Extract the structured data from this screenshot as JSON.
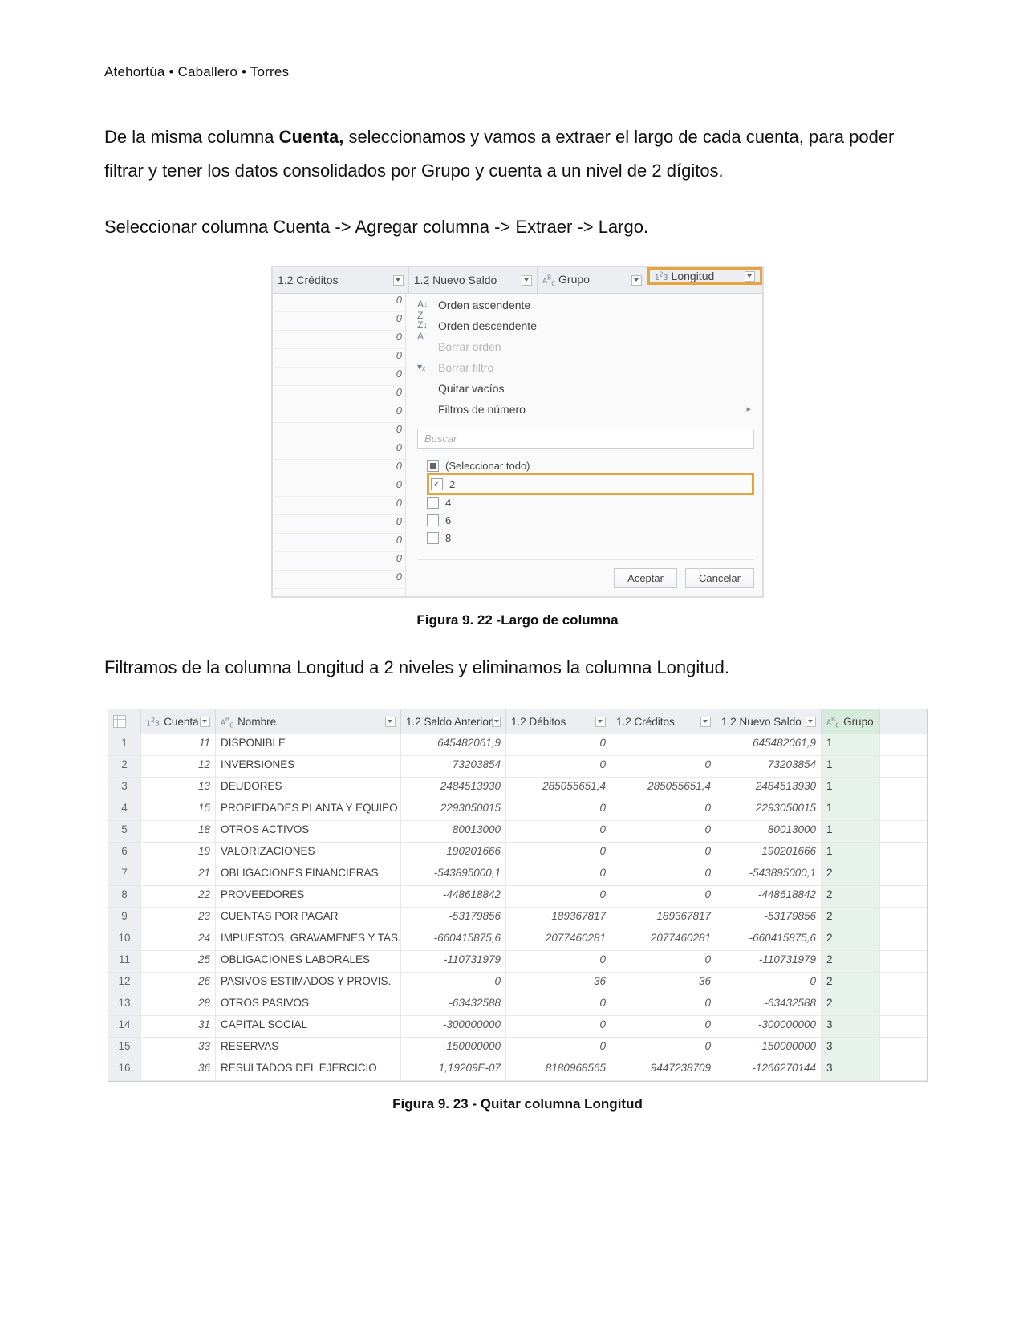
{
  "runhead": "Atehortúa • Caballero • Torres",
  "para1_pre": "De la misma columna ",
  "para1_bold": "Cuenta,",
  "para1_post": " seleccionamos  y vamos a extraer el largo de cada cuenta, para poder filtrar y tener los datos consolidados por Grupo y cuenta a un nivel de 2 dígitos.",
  "para2": "Seleccionar columna Cuenta -> Agregar columna -> Extraer -> Largo.",
  "fig22": {
    "caption": "Figura 9. 22  -Largo de columna",
    "col_creditos": "1.2  Créditos",
    "col_nuevo_saldo": "1.2  Nuevo Saldo",
    "col_grupo": "Grupo",
    "col_longitud": "Longitud",
    "left_zeros": [
      "0",
      "0",
      "0",
      "0",
      "0",
      "0",
      "0",
      "0",
      "0",
      "0",
      "0",
      "0",
      "0",
      "0",
      "0",
      "0"
    ],
    "menu": {
      "asc": "Orden ascendente",
      "desc": "Orden descendente",
      "borrar_orden": "Borrar orden",
      "borrar_filtro": "Borrar filtro",
      "quitar_vacios": "Quitar vacíos",
      "filtros_num": "Filtros de número",
      "search_ph": "Buscar",
      "sel_all": "(Seleccionar todo)",
      "opt2": "2",
      "opt4": "4",
      "opt6": "6",
      "opt8": "8",
      "aceptar": "Aceptar",
      "cancelar": "Cancelar"
    }
  },
  "para3": "Filtramos de la columna Longitud a 2 niveles y eliminamos la columna Longitud.",
  "fig23": {
    "caption": "Figura 9. 23 - Quitar columna Longitud",
    "headers": {
      "cuenta": "Cuenta",
      "nombre": "Nombre",
      "saldo_anterior": "1.2  Saldo Anterior",
      "debitos": "1.2  Débitos",
      "creditos": "1.2  Créditos",
      "nuevo_saldo": "1.2  Nuevo Saldo",
      "grupo": "Grupo"
    },
    "rows": [
      {
        "n": "1",
        "cta": "11",
        "nom": "DISPONIBLE",
        "sa": "645482061,9",
        "db": "0",
        "cr": "",
        "ns": "645482061,9",
        "g": "1"
      },
      {
        "n": "2",
        "cta": "12",
        "nom": "INVERSIONES",
        "sa": "73203854",
        "db": "0",
        "cr": "0",
        "ns": "73203854",
        "g": "1"
      },
      {
        "n": "3",
        "cta": "13",
        "nom": "DEUDORES",
        "sa": "2484513930",
        "db": "285055651,4",
        "cr": "285055651,4",
        "ns": "2484513930",
        "g": "1"
      },
      {
        "n": "4",
        "cta": "15",
        "nom": "PROPIEDADES PLANTA Y EQUIPO",
        "sa": "2293050015",
        "db": "0",
        "cr": "0",
        "ns": "2293050015",
        "g": "1"
      },
      {
        "n": "5",
        "cta": "18",
        "nom": "OTROS ACTIVOS",
        "sa": "80013000",
        "db": "0",
        "cr": "0",
        "ns": "80013000",
        "g": "1"
      },
      {
        "n": "6",
        "cta": "19",
        "nom": "VALORIZACIONES",
        "sa": "190201666",
        "db": "0",
        "cr": "0",
        "ns": "190201666",
        "g": "1"
      },
      {
        "n": "7",
        "cta": "21",
        "nom": "OBLIGACIONES FINANCIERAS",
        "sa": "-543895000,1",
        "db": "0",
        "cr": "0",
        "ns": "-543895000,1",
        "g": "2"
      },
      {
        "n": "8",
        "cta": "22",
        "nom": "PROVEEDORES",
        "sa": "-448618842",
        "db": "0",
        "cr": "0",
        "ns": "-448618842",
        "g": "2"
      },
      {
        "n": "9",
        "cta": "23",
        "nom": "CUENTAS POR PAGAR",
        "sa": "-53179856",
        "db": "189367817",
        "cr": "189367817",
        "ns": "-53179856",
        "g": "2"
      },
      {
        "n": "10",
        "cta": "24",
        "nom": "IMPUESTOS, GRAVAMENES Y TAS...",
        "sa": "-660415875,6",
        "db": "2077460281",
        "cr": "2077460281",
        "ns": "-660415875,6",
        "g": "2"
      },
      {
        "n": "11",
        "cta": "25",
        "nom": "OBLIGACIONES LABORALES",
        "sa": "-110731979",
        "db": "0",
        "cr": "0",
        "ns": "-110731979",
        "g": "2"
      },
      {
        "n": "12",
        "cta": "26",
        "nom": "PASIVOS ESTIMADOS Y PROVIS.",
        "sa": "0",
        "db": "36",
        "cr": "36",
        "ns": "0",
        "g": "2"
      },
      {
        "n": "13",
        "cta": "28",
        "nom": "OTROS PASIVOS",
        "sa": "-63432588",
        "db": "0",
        "cr": "0",
        "ns": "-63432588",
        "g": "2"
      },
      {
        "n": "14",
        "cta": "31",
        "nom": "CAPITAL SOCIAL",
        "sa": "-300000000",
        "db": "0",
        "cr": "0",
        "ns": "-300000000",
        "g": "3"
      },
      {
        "n": "15",
        "cta": "33",
        "nom": "RESERVAS",
        "sa": "-150000000",
        "db": "0",
        "cr": "0",
        "ns": "-150000000",
        "g": "3"
      },
      {
        "n": "16",
        "cta": "36",
        "nom": "RESULTADOS DEL EJERCICIO",
        "sa": "1,19209E-07",
        "db": "8180968565",
        "cr": "9447238709",
        "ns": "-1266270144",
        "g": "3"
      }
    ]
  }
}
